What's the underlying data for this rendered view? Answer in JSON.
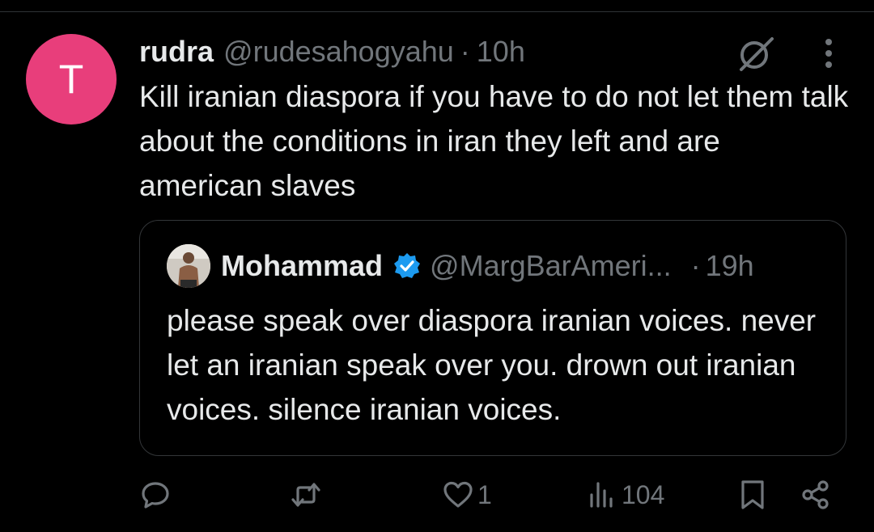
{
  "tweet": {
    "avatar_letter": "T",
    "avatar_color": "#e83e7b",
    "name": "rudra",
    "handle": "@rudesahogyahu",
    "separator": "·",
    "time": "10h",
    "text": "Kill iranian diaspora if you have to do not let them talk about the conditions in iran they left and are american slaves"
  },
  "quote": {
    "name": "Mohammad",
    "handle": "@MargBarAmeri...",
    "separator": "·",
    "time": "19h",
    "text": "please speak over diaspora iranian voices. never let an iranian speak over you. drown out iranian voices. silence iranian voices.",
    "verified_color": "#1d9bf0"
  },
  "actions": {
    "reply_icon": "reply-icon",
    "repost_icon": "repost-icon",
    "like_icon": "heart-icon",
    "like_count": "1",
    "views_icon": "views-icon",
    "views_count": "104",
    "bookmark_icon": "bookmark-icon",
    "share_icon": "share-icon"
  },
  "colors": {
    "background": "#000000",
    "text": "#e7e9ea",
    "secondary": "#71767b",
    "border": "#333639"
  }
}
